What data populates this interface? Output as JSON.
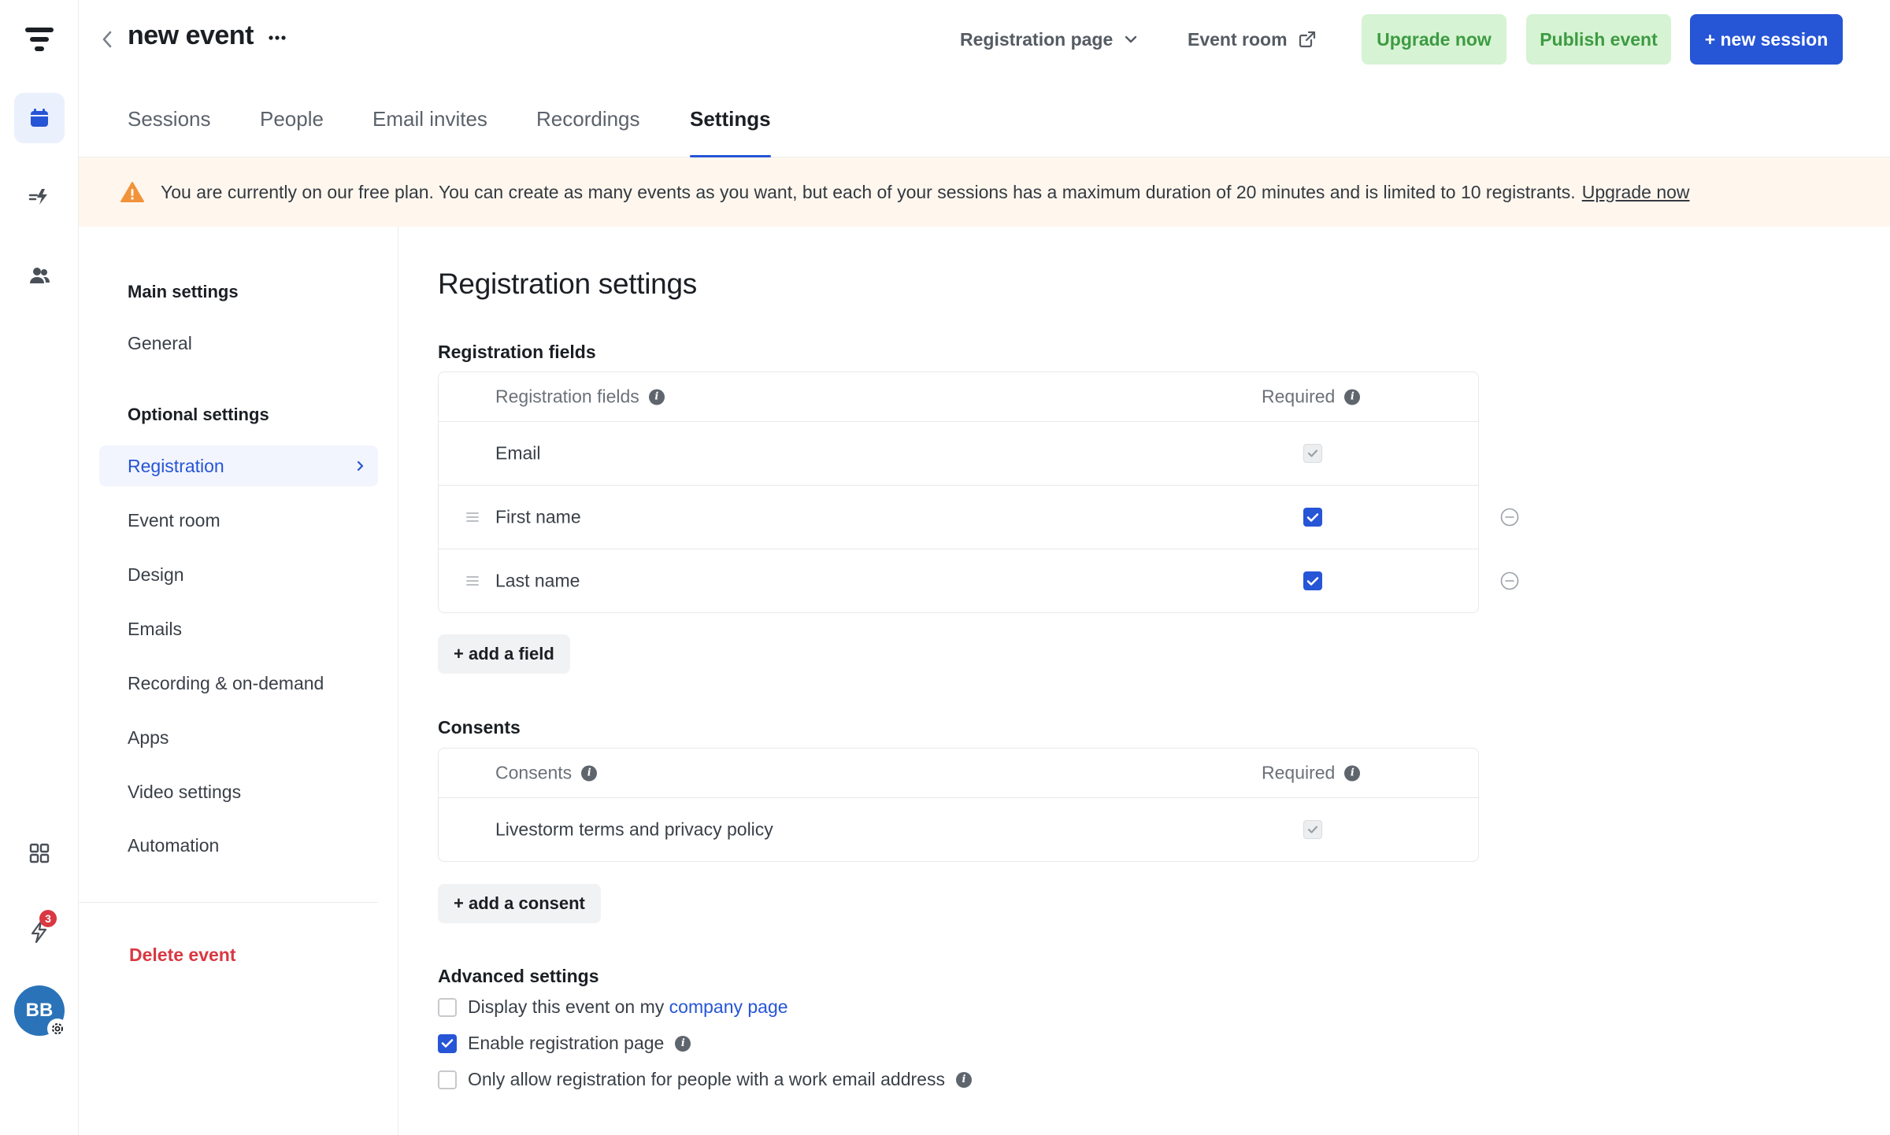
{
  "header": {
    "title": "new event",
    "registration_page": "Registration page",
    "event_room": "Event room",
    "upgrade_now": "Upgrade now",
    "publish_event": "Publish event",
    "new_session": "+ new session"
  },
  "rail": {
    "notifications_count": "3",
    "avatar_initials": "BB"
  },
  "tabs": [
    {
      "label": "Sessions"
    },
    {
      "label": "People"
    },
    {
      "label": "Email invites"
    },
    {
      "label": "Recordings"
    },
    {
      "label": "Settings",
      "active": true
    }
  ],
  "banner": {
    "text": "You are currently on our free plan. You can create as many events as you want, but each of your sessions has a maximum duration of 20 minutes and is limited to 10 registrants.",
    "link": "Upgrade now"
  },
  "settings_nav": {
    "main_heading": "Main settings",
    "main_items": [
      "General"
    ],
    "optional_heading": "Optional settings",
    "optional_items": [
      "Registration",
      "Event room",
      "Design",
      "Emails",
      "Recording & on-demand",
      "Apps",
      "Video settings",
      "Automation"
    ],
    "active_item": "Registration",
    "delete_label": "Delete event"
  },
  "registration": {
    "title": "Registration settings",
    "fields_section": "Registration fields",
    "fields_header": {
      "name": "Registration fields",
      "required": "Required"
    },
    "fields": [
      {
        "name": "Email",
        "required": true,
        "locked": true
      },
      {
        "name": "First name",
        "required": true,
        "locked": false
      },
      {
        "name": "Last name",
        "required": true,
        "locked": false
      }
    ],
    "add_field": "+ add a field",
    "consents_section": "Consents",
    "consents_header": {
      "name": "Consents",
      "required": "Required"
    },
    "consents": [
      {
        "name": "Livestorm terms and privacy policy",
        "required": true,
        "locked": true
      }
    ],
    "add_consent": "+ add a consent",
    "advanced_section": "Advanced settings",
    "advanced": {
      "display_company_prefix": "Display this event on my",
      "display_company_link": "company page",
      "display_company_checked": false,
      "enable_registration": "Enable registration page",
      "enable_registration_checked": true,
      "work_email_only": "Only allow registration for people with a work email address",
      "work_email_only_checked": false
    }
  },
  "colors": {
    "accent": "#2655d6",
    "success_bg": "#d6f3d3",
    "success_text": "#3d9b42",
    "danger": "#d93842",
    "warning": "#f2933a",
    "banner_bg": "#fff7ee"
  }
}
